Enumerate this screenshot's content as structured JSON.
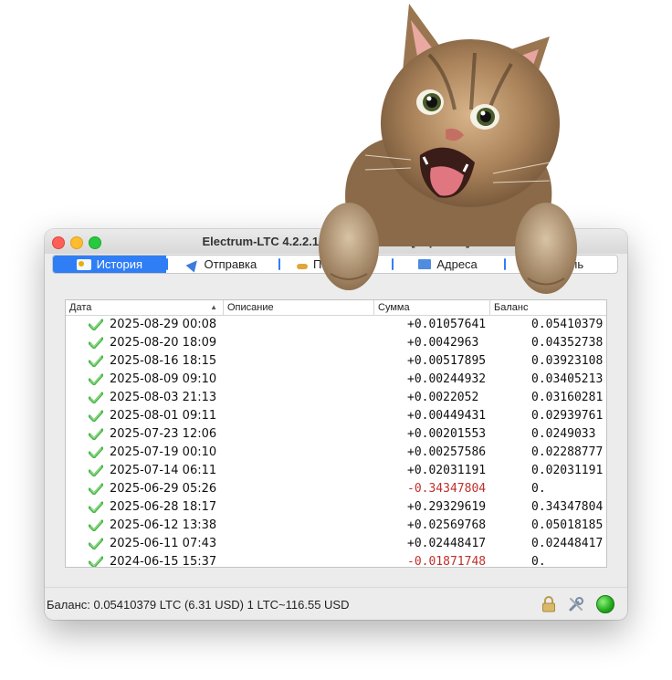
{
  "window": {
    "title": "Electrum-LTC 4.2.2.1  -  default_wallet  [imported]"
  },
  "tabs": [
    {
      "label": "История",
      "icon": "history-icon",
      "active": true
    },
    {
      "label": "Отправка",
      "icon": "send-icon",
      "active": false
    },
    {
      "label": "Получение",
      "icon": "receive-icon",
      "active": false
    },
    {
      "label": "Адреса",
      "icon": "addresses-icon",
      "active": false
    },
    {
      "label": "Консоль",
      "icon": "console-icon",
      "active": false
    }
  ],
  "history": {
    "columns": [
      "Дата",
      "Описание",
      "Сумма",
      "Баланс"
    ],
    "rows": [
      {
        "date": "2025-08-29 00:08",
        "amount": "+0.01057641",
        "balance": "0.05410379"
      },
      {
        "date": "2025-08-20 18:09",
        "amount": "+0.0042963",
        "balance": "0.04352738"
      },
      {
        "date": "2025-08-16 18:15",
        "amount": "+0.00517895",
        "balance": "0.03923108"
      },
      {
        "date": "2025-08-09 09:10",
        "amount": "+0.00244932",
        "balance": "0.03405213"
      },
      {
        "date": "2025-08-03 21:13",
        "amount": "+0.0022052",
        "balance": "0.03160281"
      },
      {
        "date": "2025-08-01 09:11",
        "amount": "+0.00449431",
        "balance": "0.02939761"
      },
      {
        "date": "2025-07-23 12:06",
        "amount": "+0.00201553",
        "balance": "0.0249033"
      },
      {
        "date": "2025-07-19 00:10",
        "amount": "+0.00257586",
        "balance": "0.02288777"
      },
      {
        "date": "2025-07-14 06:11",
        "amount": "+0.02031191",
        "balance": "0.02031191"
      },
      {
        "date": "2025-06-29 05:26",
        "amount": "-0.34347804",
        "balance": "0."
      },
      {
        "date": "2025-06-28 18:17",
        "amount": "+0.29329619",
        "balance": "0.34347804"
      },
      {
        "date": "2025-06-12 13:38",
        "amount": "+0.02569768",
        "balance": "0.05018185"
      },
      {
        "date": "2025-06-11 07:43",
        "amount": "+0.02448417",
        "balance": "0.02448417"
      },
      {
        "date": "2024-06-15 15:37",
        "amount": "-0.01871748",
        "balance": "0."
      }
    ]
  },
  "status": {
    "text": "Баланс: 0.05410379 LTC (6.31 USD)  1 LTC~116.55 USD"
  },
  "colors": {
    "accent": "#2f7ef6",
    "negative": "#c0302a",
    "confirmed": "#4bb74a",
    "online": "#22a81b"
  }
}
